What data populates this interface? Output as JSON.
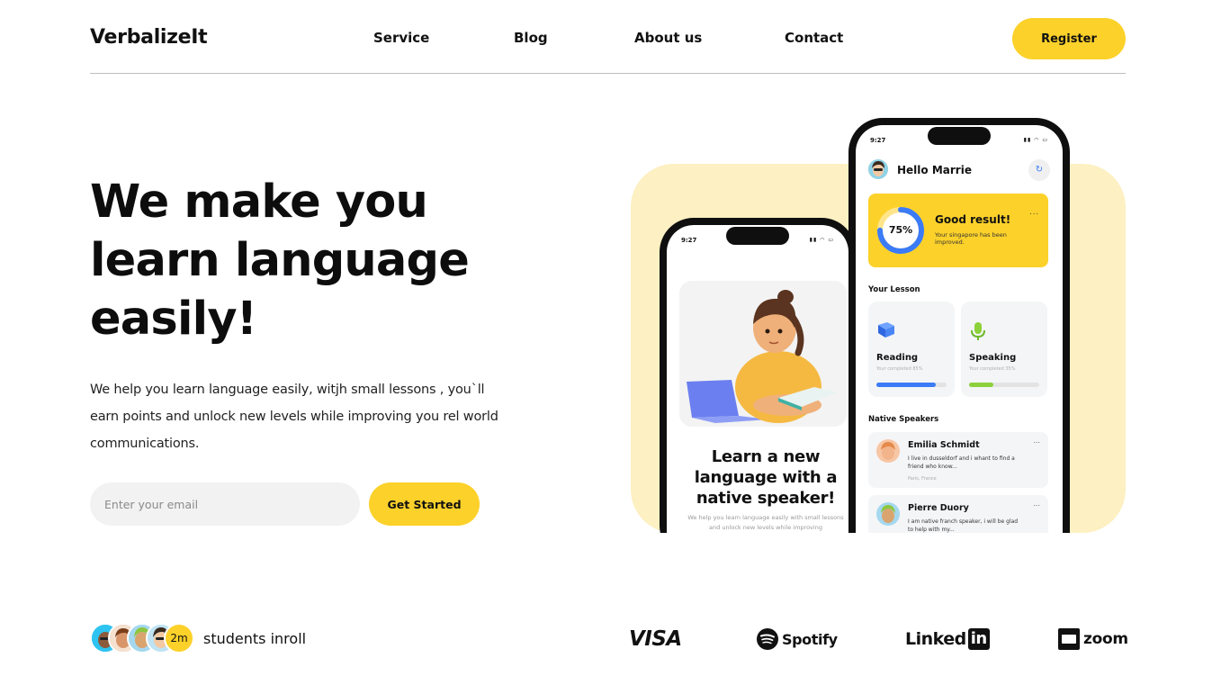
{
  "header": {
    "logo": "VerbalizeIt",
    "nav": [
      "Service",
      "Blog",
      "About us",
      "Contact"
    ],
    "register_label": "Register"
  },
  "hero": {
    "title_lines": [
      "We make you",
      "learn language",
      "easily!"
    ],
    "description": "We help you learn language easily, witjh small lessons , you`ll earn points and unlock new levels while improving you rel world communications.",
    "email_placeholder": "Enter your email",
    "cta_label": "Get Started"
  },
  "phone_back": {
    "time": "9:27",
    "title": "Learn a new language with a native speaker!",
    "subtitle": "We help you learn language easily with small lessons and unlock new levels while improving"
  },
  "phone_front": {
    "time": "9:27",
    "greeting": "Hello Marrie",
    "result": {
      "percent_label": "75%",
      "progress": 0.75,
      "title": "Good result!",
      "subtitle": "Your singapore has been improved.",
      "menu": "..."
    },
    "lessons_label": "Your Lesson",
    "lessons": [
      {
        "name": "Reading",
        "sub": "Your completed 85%",
        "progress": 0.85,
        "color": "#3b7bf6",
        "icon": "book-icon"
      },
      {
        "name": "Speaking",
        "sub": "Your completed 35%",
        "progress": 0.35,
        "color": "#8dd13a",
        "icon": "microphone-icon"
      }
    ],
    "speakers_label": "Native Speakers",
    "speakers": [
      {
        "name": "Emilia Schmidt",
        "message": "I live in dusseldorf and i whant to find a friend who know...",
        "location": "Paris, France",
        "menu": "..."
      },
      {
        "name": "Pierre Duory",
        "message": "I am native franch speaker, i will be glad to help with my...",
        "location": "",
        "menu": "..."
      }
    ]
  },
  "students": {
    "count": "2m",
    "label": "students inroll"
  },
  "brands": [
    "VISA",
    "Spotify",
    "Linked",
    "in",
    "zoom"
  ],
  "colors": {
    "accent": "#fcd12a",
    "accent_soft": "#fdf0c2",
    "text": "#111111",
    "reading": "#3b7bf6",
    "speaking": "#8dd13a"
  }
}
